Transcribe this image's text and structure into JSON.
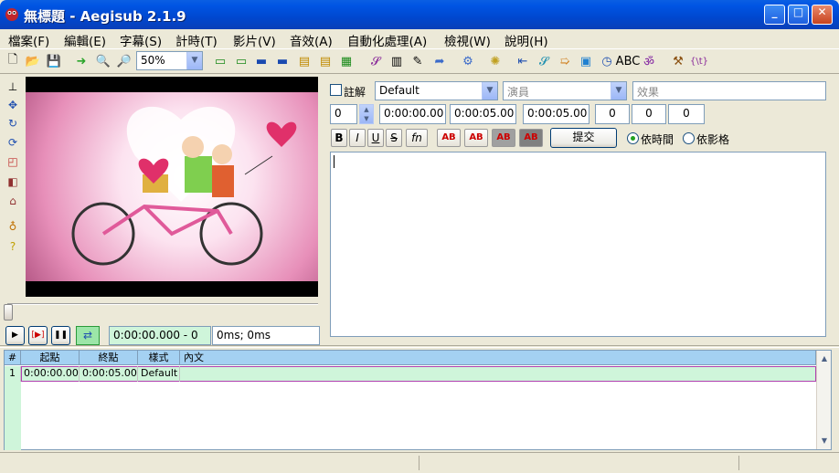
{
  "window": {
    "title": "無標題 - Aegisub 2.1.9",
    "minimize": "_",
    "maximize": "□",
    "close": "✕"
  },
  "menu": [
    "檔案(F)",
    "編輯(E)",
    "字幕(S)",
    "計時(T)",
    "影片(V)",
    "音效(A)",
    "自動化處理(A)",
    "檢視(W)",
    "說明(H)"
  ],
  "toolbar": {
    "zoom": "50%"
  },
  "editbox": {
    "comment_label": "註解",
    "style": "Default",
    "actor_placeholder": "演員",
    "effect_placeholder": "效果",
    "layer": "0",
    "start": "0:00:00.00",
    "end": "0:00:05.00",
    "duration": "0:00:05.00",
    "margin_l": "0",
    "margin_r": "0",
    "margin_v": "0",
    "bold": "B",
    "italic": "I",
    "underline": "U",
    "strike": "S",
    "fn": "fn",
    "color_labels": [
      "AB",
      "AB",
      "AB",
      "AB"
    ],
    "commit": "提交",
    "by_time": "依時間",
    "by_frame": "依影格"
  },
  "video": {
    "time_display": "0:00:00.000 - 0",
    "offset_display": "0ms; 0ms"
  },
  "grid": {
    "headers": [
      "#",
      "起點",
      "終點",
      "樣式",
      "內文"
    ],
    "rows": [
      [
        "1",
        "0:00:00.00",
        "0:00:05.00",
        "Default",
        ""
      ]
    ]
  },
  "colors": {
    "title_blue": "#0054E3",
    "grid_header": "#A4D1F2",
    "row_highlight": "#CFF5DA"
  }
}
